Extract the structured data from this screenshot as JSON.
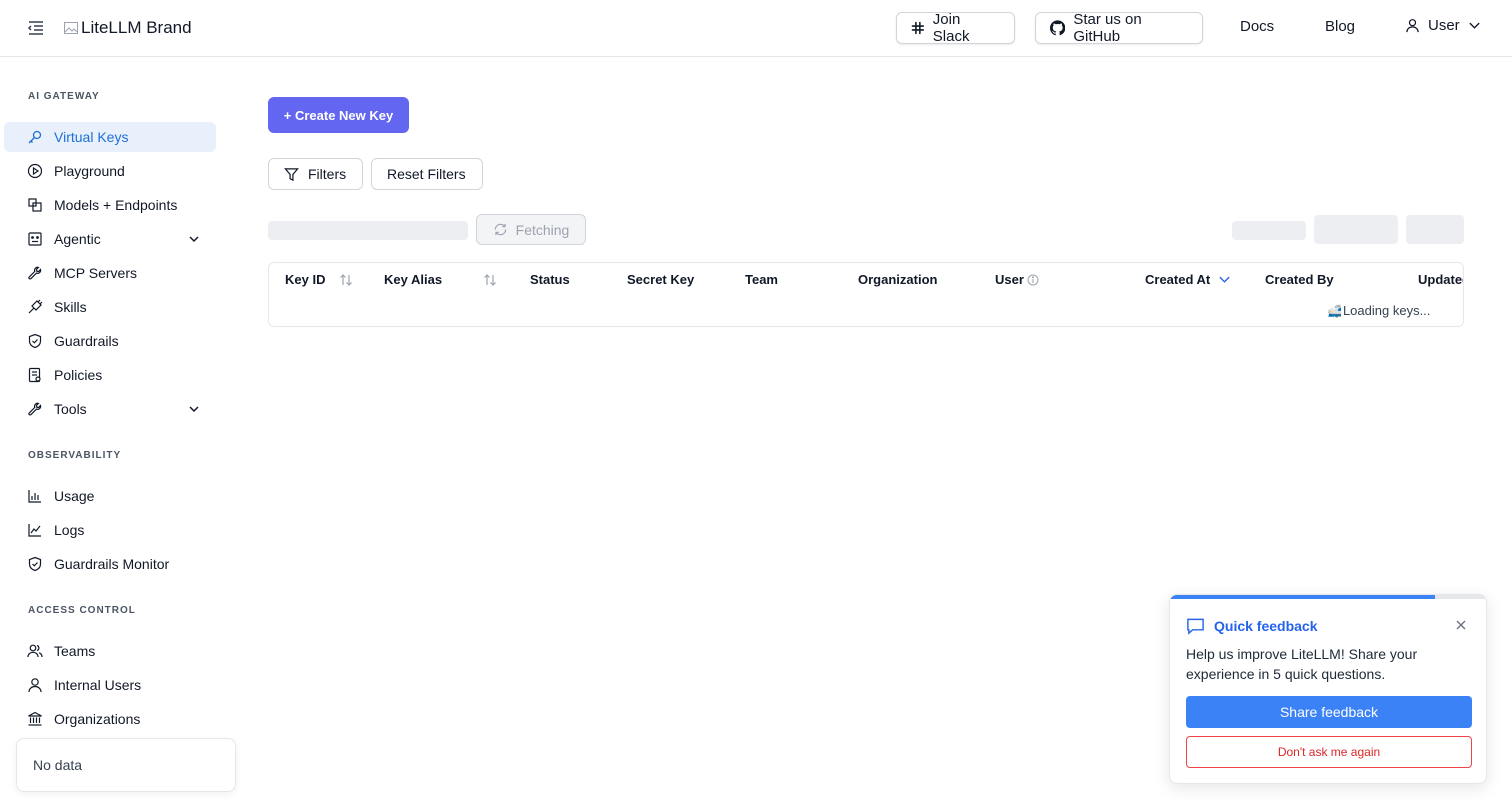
{
  "header": {
    "brand_alt": "LiteLLM Brand",
    "slack_label": "Join Slack",
    "github_label": "Star us on GitHub",
    "docs_label": "Docs",
    "blog_label": "Blog",
    "user_label": "User"
  },
  "sidebar": {
    "sections": [
      {
        "title": "AI GATEWAY",
        "items": [
          {
            "label": "Virtual Keys",
            "icon": "key-icon",
            "active": true
          },
          {
            "label": "Playground",
            "icon": "play-circle-icon"
          },
          {
            "label": "Models + Endpoints",
            "icon": "blocks-icon"
          },
          {
            "label": "Agentic",
            "icon": "robot-icon",
            "expandable": true
          },
          {
            "label": "MCP Servers",
            "icon": "wrench-icon"
          },
          {
            "label": "Skills",
            "icon": "plug-icon"
          },
          {
            "label": "Guardrails",
            "icon": "shield-icon"
          },
          {
            "label": "Policies",
            "icon": "policy-icon"
          },
          {
            "label": "Tools",
            "icon": "tool-icon",
            "expandable": true
          }
        ]
      },
      {
        "title": "OBSERVABILITY",
        "items": [
          {
            "label": "Usage",
            "icon": "bar-chart-icon"
          },
          {
            "label": "Logs",
            "icon": "line-chart-icon"
          },
          {
            "label": "Guardrails Monitor",
            "icon": "shield-icon"
          }
        ]
      },
      {
        "title": "ACCESS CONTROL",
        "items": [
          {
            "label": "Teams",
            "icon": "team-icon"
          },
          {
            "label": "Internal Users",
            "icon": "user-icon"
          },
          {
            "label": "Organizations",
            "icon": "bank-icon"
          }
        ]
      }
    ],
    "nodata_text": "No data"
  },
  "main": {
    "create_key_label": "+ Create New Key",
    "filters_label": "Filters",
    "reset_filters_label": "Reset Filters",
    "fetching_label": "Fetching",
    "table": {
      "columns": [
        "Key ID",
        "Key Alias",
        "Status",
        "Secret Key",
        "Team",
        "Organization",
        "User",
        "Created At",
        "Created By",
        "Updated"
      ],
      "loading_text": "Loading keys..."
    }
  },
  "feedback": {
    "title": "Quick feedback",
    "text": "Help us improve LiteLLM! Share your experience in 5 quick questions.",
    "share_label": "Share feedback",
    "dont_ask_label": "Don't ask me again",
    "progress": 0.84
  },
  "colors": {
    "primary": "#6366f1",
    "active_nav_bg": "#e8f0fc",
    "active_nav_text": "#1f6fd6",
    "feedback_blue": "#3b82f6",
    "danger": "#dc2626"
  }
}
